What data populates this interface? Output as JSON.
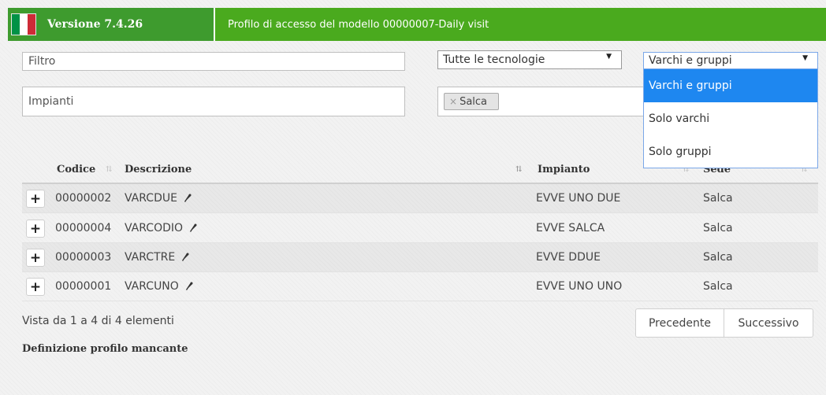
{
  "header": {
    "version_label": "Versione 7.4.26",
    "title": "Profilo di accesso del modello 00000007-Daily visit",
    "flag_colors": [
      "#009246",
      "#ffffff",
      "#ce2b37"
    ]
  },
  "filters": {
    "filter_placeholder": "Filtro",
    "technology_select": "Tutte le tecnologie",
    "type_select": "Varchi e gruppi",
    "plants_placeholder": "Impianti",
    "plant_tag": "Salca",
    "tag_remove_symbol": "×",
    "select_arrow": "▼"
  },
  "dropdown": {
    "options": [
      "Varchi e gruppi",
      "Solo varchi",
      "Solo gruppi"
    ],
    "selected_index": 0
  },
  "table": {
    "headers": {
      "codice": "Codice",
      "descrizione": "Descrizione",
      "impianto": "Impianto",
      "sede": "Sede"
    },
    "rows": [
      {
        "codice": "00000002",
        "descrizione": "VARCDUE",
        "impianto": "EVVE UNO DUE",
        "sede": "Salca"
      },
      {
        "codice": "00000004",
        "descrizione": "VARCODIO",
        "impianto": "EVVE SALCA",
        "sede": "Salca"
      },
      {
        "codice": "00000003",
        "descrizione": "VARCTRE",
        "impianto": "EVVE DDUE",
        "sede": "Salca"
      },
      {
        "codice": "00000001",
        "descrizione": "VARCUNO",
        "impianto": "EVVE UNO UNO",
        "sede": "Salca"
      }
    ],
    "expand_symbol": "+"
  },
  "footer": {
    "info": "Vista da 1 a 4 di 4 elementi",
    "missing_definition": "Definizione profilo mancante"
  },
  "pagination": {
    "prev": "Precedente",
    "next": "Successivo"
  },
  "colors": {
    "header_dark_green": "#3e9b2e",
    "header_green": "#4aaa1e",
    "dropdown_highlight": "#1e87f0"
  }
}
